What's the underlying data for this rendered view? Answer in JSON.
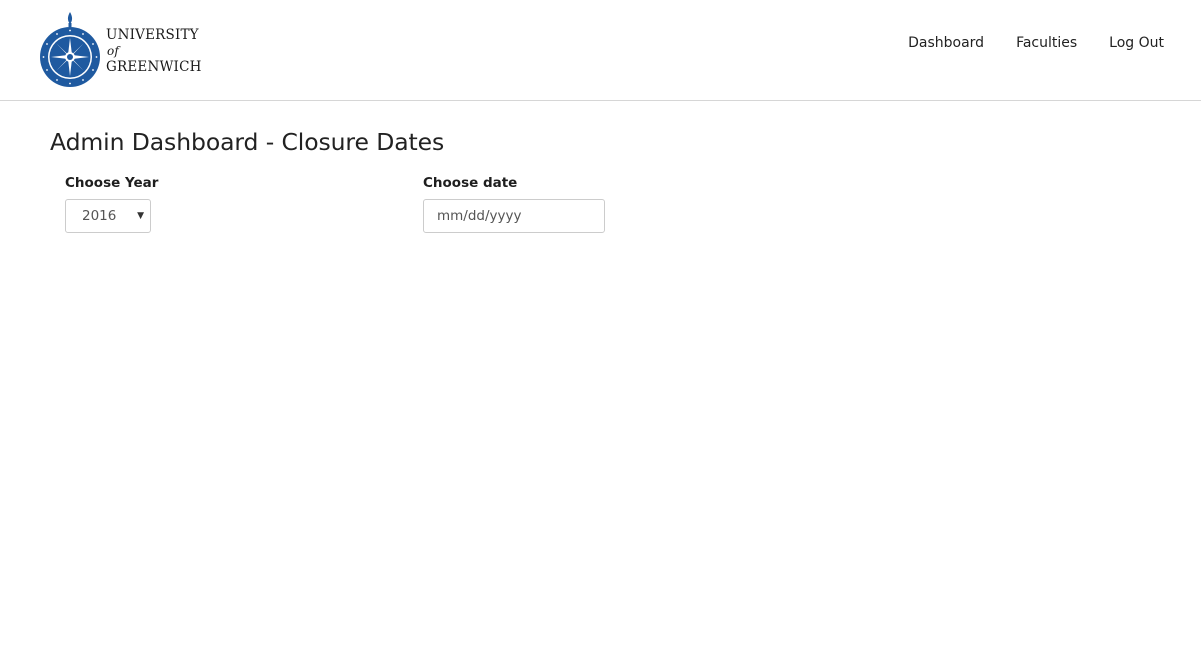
{
  "brand": {
    "line1": "UNIVERSITY",
    "line2": "of",
    "line3": "GREENWICH",
    "seal_icon": "university-seal-icon",
    "color": "#1f5aa0"
  },
  "nav": {
    "items": [
      {
        "label": "Dashboard"
      },
      {
        "label": "Faculties"
      },
      {
        "label": "Log Out"
      }
    ]
  },
  "page": {
    "title": "Admin Dashboard - Closure Dates"
  },
  "form": {
    "year_label": "Choose Year",
    "year_value": "2016",
    "caret_icon": "caret-down-icon",
    "date_label": "Choose date",
    "date_placeholder": "mm/dd/yyyy",
    "date_value": ""
  }
}
